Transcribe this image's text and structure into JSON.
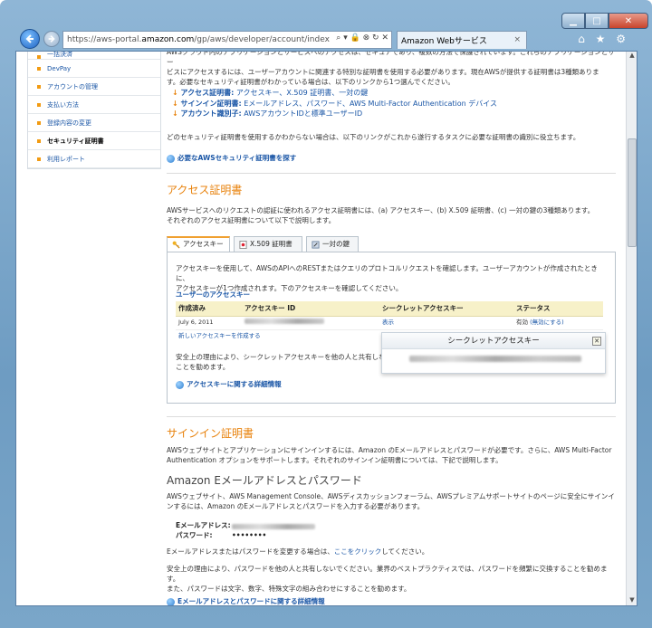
{
  "browser": {
    "url_prefix": "https://aws-portal.",
    "url_domain": "amazon.com",
    "url_suffix": "/gp/aws/developer/account/index",
    "url_icons": "⌕ ▾ 🔒 ⊗ ↻ ✕",
    "tab_title": "Amazon Webサービス",
    "tab_close": "×",
    "toolbar_icons": "⌂ ★ ⚙",
    "minimize": "▁",
    "maximize": "□",
    "close": "✕"
  },
  "sidebar": {
    "items": [
      {
        "label": "一括決済"
      },
      {
        "label": "DevPay"
      },
      {
        "label": "アカウントの管理"
      },
      {
        "label": "支払い方法"
      },
      {
        "label": "登録内容の変更"
      },
      {
        "label": "セキュリティ証明書"
      },
      {
        "label": "利用レポート"
      }
    ]
  },
  "intro": {
    "line1": "AWSクラウド内のアプリケーションとサービスへのアクセスは、セキュアであり、複数の方法で保護されています。これらのアプリケーションとサー",
    "line2": "ビスにアクセスするには、ユーザーアカウントに関連する特別な証明書を使用する必要があります。現在AWSが提供する証明書は3種類ありま",
    "line3": "す。必要なセキュリティ証明書がわかっている場合は、以下のリンクから1つ選んでください。"
  },
  "bullets": [
    {
      "term": "アクセス証明書:",
      "desc": " アクセスキー、X.509 証明書、一対の鍵"
    },
    {
      "term": "サインイン証明書:",
      "desc": " Eメールアドレス、パスワード、AWS Multi-Factor Authentication デバイス"
    },
    {
      "term": "アカウント識別子:",
      "desc": " AWSアカウントIDと標準ユーザーID"
    }
  ],
  "unsure_text": "どのセキュリティ証明書を使用するかわからない場合は、以下のリンクがこれから遂行するタスクに必要な証明書の識別に役立ちます。",
  "find_link": "必要なAWSセキュリティ証明書を探す",
  "access": {
    "title": "アクセス証明書",
    "desc1": "AWSサービスへのリクエストの認証に使われるアクセス証明書には、(a) アクセスキー、(b) X.509 証明書、(c) 一対の鍵の3種類あります。",
    "desc2": "それぞれのアクセス証明書について以下で説明します。",
    "tabs": [
      "アクセスキー",
      "X.509 証明書",
      "一対の鍵"
    ],
    "panel_desc1": "アクセスキーを使用して、AWSのAPIへのRESTまたはクエリのプロトコルリクエストを確認します。ユーザーアカウントが作成されたときに、",
    "panel_desc2": "アクセスキーが1つ作成されます。下のアクセスキーを確認してください。",
    "your_keys": "ユーザーのアクセスキー",
    "columns": [
      "作成済み",
      "アクセスキー ID",
      "シークレットアクセスキー",
      "ステータス"
    ],
    "row": {
      "created": "July 6, 2011",
      "show": "表示",
      "status": "有効",
      "deactivate": "(無効にする)"
    },
    "new_key": "新しいアクセスキーを作成する",
    "security_note": "安全上の理由により、シークレットアクセスキーを他の人と共有しな",
    "security_note2": "ことを勧めます。",
    "more": "アクセスキーに関する詳細情報"
  },
  "popup": {
    "title": "シークレットアクセスキー",
    "close": "✕"
  },
  "signin": {
    "title": "サインイン証明書",
    "desc1": "AWSウェブサイトとアプリケーションにサインインするには、Amazon のEメールアドレスとパスワードが必要です。さらに、AWS Multi-Factor",
    "desc2": "Authentication オプションをサポートします。それぞれのサインイン証明書については、下記で説明します。",
    "subtitle": "Amazon Eメールアドレスとパスワード",
    "sub_desc1": "AWSウェブサイト、AWS Management Console、AWSディスカッションフォーラム、AWSプレミアムサポートサイトのページに安全にサインイ",
    "sub_desc2": "ンするには、Amazon のEメールアドレスとパスワードを入力する必要があります。",
    "email_label": "Eメールアドレス:",
    "password_label": "パスワード:",
    "password_value": "••••••••",
    "change_prefix": "Eメールアドレスまたはパスワードを変更する場合は、",
    "change_link": "ここをクリック",
    "change_suffix": "してください。",
    "note1": "安全上の理由により、パスワードを他の人と共有しないでください。業界のベストプラクティスでは、パスワードを頻繁に交換することを勧めます。",
    "note2": "また、パスワードは文字、数字、特殊文字の組み合わせにすることを勧めます。",
    "more": "Eメールアドレスとパスワードに関する詳細情報"
  }
}
